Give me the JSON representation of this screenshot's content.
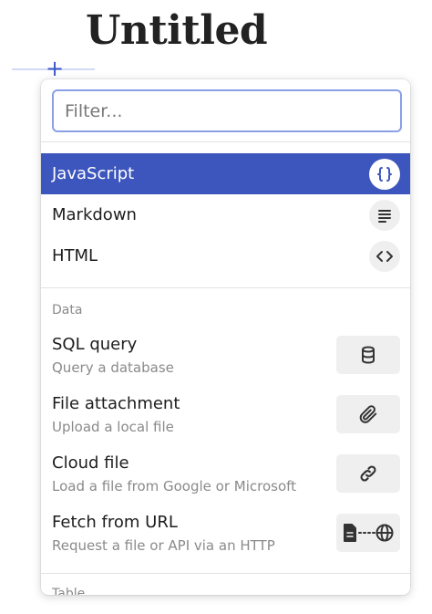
{
  "page": {
    "title": "Untitled"
  },
  "insert": {
    "plus": "+"
  },
  "filter": {
    "placeholder": "Filter..."
  },
  "code_items": [
    {
      "label": "JavaScript",
      "icon": "curly-braces-icon",
      "active": true
    },
    {
      "label": "Markdown",
      "icon": "text-lines-icon",
      "active": false
    },
    {
      "label": "HTML",
      "icon": "angle-brackets-icon",
      "active": false
    }
  ],
  "data_section": {
    "label": "Data",
    "items": [
      {
        "title": "SQL query",
        "subtitle": "Query a database",
        "icon": "database-icon"
      },
      {
        "title": "File attachment",
        "subtitle": "Upload a local file",
        "icon": "paperclip-icon"
      },
      {
        "title": "Cloud file",
        "subtitle": "Load a file from Google or Microsoft",
        "icon": "link-icon"
      },
      {
        "title": "Fetch from URL",
        "subtitle": "Request a file or API via an HTTP",
        "icon": "file-globe-icon"
      }
    ]
  },
  "next_section": {
    "label": "Table"
  },
  "colors": {
    "accent": "#3d56bd",
    "icon_bg": "#efefef",
    "muted": "#8a8a8a"
  }
}
